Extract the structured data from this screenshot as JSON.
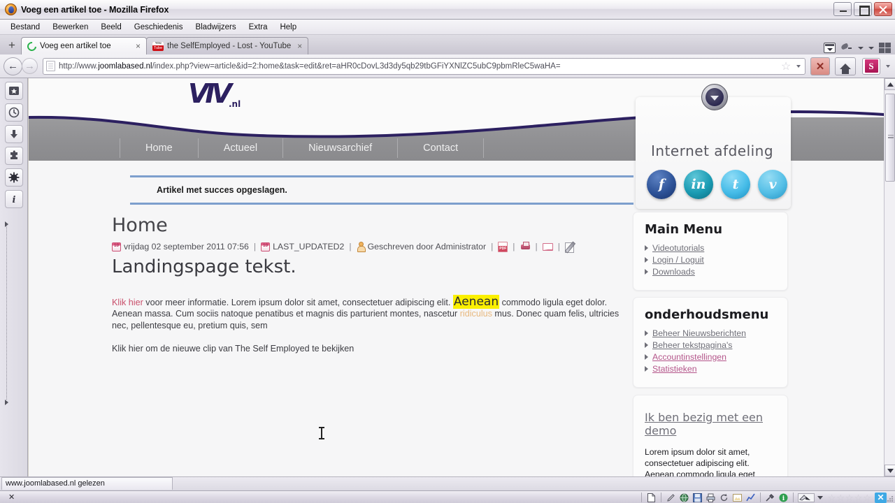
{
  "window": {
    "title": "Voeg een artikel toe - Mozilla Firefox",
    "app_icon": "firefox-icon",
    "minimize_label": "Minimaliseren",
    "maximize_label": "Maximaliseren",
    "close_label": "Sluiten"
  },
  "menubar": {
    "items": [
      {
        "label": "Bestand"
      },
      {
        "label": "Bewerken"
      },
      {
        "label": "Beeld"
      },
      {
        "label": "Geschiedenis"
      },
      {
        "label": "Bladwijzers"
      },
      {
        "label": "Extra"
      },
      {
        "label": "Help"
      }
    ]
  },
  "tabs": {
    "new_tab_label": "+",
    "items": [
      {
        "title": "Voeg een artikel toe",
        "favicon": "firefox-icon",
        "active": true,
        "close_label": "×"
      },
      {
        "title": "the SelfEmployed - Lost - YouTube",
        "favicon": "youtube-icon",
        "active": false,
        "close_label": "×"
      }
    ],
    "list_all_tabs_label": "Alle tabbladen tonen"
  },
  "navbar": {
    "back_label": "←",
    "forward_label": "→",
    "url_display_prefix": "http://www.",
    "url_display_domain": "joomlabased.nl",
    "url_display_rest": "/index.php?view=article&id=2:home&task=edit&ret=aHR0cDovL3d3dy5qb29tbGFiYXNlZC5ubC9pbmRleC5waHA=",
    "url_full": "http://www.joomlabased.nl/index.php?view=article&id=2:home&task=edit&ret=aHR0cDovL3d3dy5qb29tbGFiYXNlZC5ubC9pbmRleC5waHA=",
    "bookmark_label": "☆",
    "stop_label": "✕",
    "home_label": "Start",
    "extension_label": "S"
  },
  "sidebar_toolbar": {
    "buttons": [
      {
        "icon": "bookmark-star-icon",
        "label": "Bladwijzers"
      },
      {
        "icon": "history-clock-icon",
        "label": "Geschiedenis"
      },
      {
        "icon": "download-arrow-icon",
        "label": "Downloads"
      },
      {
        "icon": "addons-puzzle-icon",
        "label": "Add-ons"
      },
      {
        "icon": "gear-star-icon",
        "label": "Extra"
      },
      {
        "icon": "info-icon",
        "label": "Info"
      }
    ]
  },
  "site": {
    "logo_text": "VIV",
    "logo_suffix": ".nl",
    "nav": [
      {
        "label": "Home"
      },
      {
        "label": "Actueel"
      },
      {
        "label": "Nieuwsarchief"
      },
      {
        "label": "Contact"
      }
    ],
    "afdeling": {
      "title": "Internet afdeling",
      "badge_icon": "chevron-down-badge-icon",
      "socials": [
        {
          "name": "facebook-icon",
          "glyph": "f"
        },
        {
          "name": "linkedin-icon",
          "glyph": "in"
        },
        {
          "name": "twitter-icon",
          "glyph": "t"
        },
        {
          "name": "vimeo-icon",
          "glyph": "v"
        }
      ]
    }
  },
  "content": {
    "system_message": "Artikel met succes opgeslagen.",
    "page_title": "Home",
    "meta": {
      "created_icon": "calendar-icon",
      "created": "vrijdag 02 september 2011 07:56",
      "updated_icon": "calendar-icon",
      "updated": "LAST_UPDATED2",
      "author_icon": "user-icon",
      "author": "Geschreven door Administrator",
      "pdf_icon": "pdf-icon",
      "print_icon": "print-icon",
      "mail_icon": "email-icon",
      "edit_icon": "edit-pencil-icon",
      "separator": "|"
    },
    "article_heading": "Landingspage tekst.",
    "paragraph1": {
      "link_text": "Klik hier",
      "text_a": " voor meer informatie. Lorem ipsum dolor sit amet, consectetuer adipiscing elit. ",
      "highlight": "Aenean",
      "text_b": " commodo ligula eget dolor. Aenean massa. Cum sociis natoque penatibus et magnis dis parturient montes, nascetur ",
      "tan_word": "ridiculus",
      "text_c": " mus. Donec quam felis, ultricies nec, pellentesque eu, pretium quis, sem"
    },
    "paragraph2": "Klik hier om de nieuwe clip van The Self Employed te bekijken"
  },
  "modules": [
    {
      "id": "main-menu",
      "title": "Main Menu",
      "links": [
        {
          "label": "Videotutorials",
          "visited": false
        },
        {
          "label": "Login / Loguit",
          "visited": false
        },
        {
          "label": "Downloads",
          "visited": false
        }
      ]
    },
    {
      "id": "onderhoudsmenu",
      "title": "onderhoudsmenu",
      "links": [
        {
          "label": "Beheer Nieuwsberichten",
          "visited": false
        },
        {
          "label": "Beheer tekstpagina's",
          "visited": false
        },
        {
          "label": "Accountinstellingen",
          "visited": true
        },
        {
          "label": "Statistieken",
          "visited": true
        }
      ]
    }
  ],
  "demo_module": {
    "link": "Ik ben bezig met een demo",
    "body": "Lorem ipsum dolor sit amet, consectetuer adipiscing elit. Aenean commodo ligula eget dolor. Aenean massa. Cum sociis natoque penatibus et magnis dis"
  },
  "statusbar": {
    "text": "www.joomlabased.nl gelezen"
  },
  "taskbar": {
    "close_label": "✕",
    "tools": [
      {
        "icon": "new-document-icon"
      },
      {
        "icon": "pen-icon"
      },
      {
        "icon": "globe-icon"
      },
      {
        "icon": "save-disk-icon"
      },
      {
        "icon": "printer-icon"
      },
      {
        "icon": "refresh-icon"
      },
      {
        "icon": "image-icon"
      },
      {
        "icon": "chart-icon"
      },
      {
        "icon": "tools-icon"
      },
      {
        "icon": "info-circle-icon"
      }
    ],
    "pointer_icon": "pointer-pen-icon",
    "dropdown_icon": "chevron-down-icon",
    "star_count": 5,
    "star_glyph": "☆",
    "close_x_label": "✕"
  },
  "colors": {
    "site_purple": "#2c2060",
    "header_grey": "#909093",
    "message_border": "#7d9fcd",
    "link_red": "#c94f6b",
    "highlight_yellow": "#fbf000",
    "visited_link": "#b4558a",
    "tan_word": "#e8b87e"
  }
}
